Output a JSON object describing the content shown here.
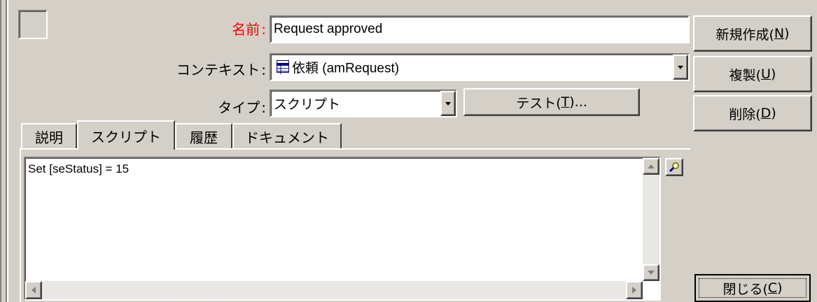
{
  "form": {
    "name_label": "名前",
    "name_value": "Request approved",
    "context_label": "コンテキスト",
    "context_value": "依頼 (amRequest)",
    "type_label": "タイプ",
    "type_value": "スクリプト",
    "test_button": "テスト(",
    "test_hotkey": "T",
    "test_suffix": ")...",
    "label_color": "#ff0000"
  },
  "tabs": [
    {
      "label": "説明"
    },
    {
      "label": "スクリプト",
      "active": true
    },
    {
      "label": "履歴"
    },
    {
      "label": "ドキュメント"
    }
  ],
  "script": {
    "text": "Set [seStatus] = 15"
  },
  "buttons": {
    "new_label": "新規作成(",
    "new_hotkey": "N",
    "dup_label": "複製(",
    "dup_hotkey": "U",
    "delete_label": "削除(",
    "delete_hotkey": "D",
    "close_label": "閉じる(",
    "close_hotkey": "C",
    "suffix": ")"
  }
}
